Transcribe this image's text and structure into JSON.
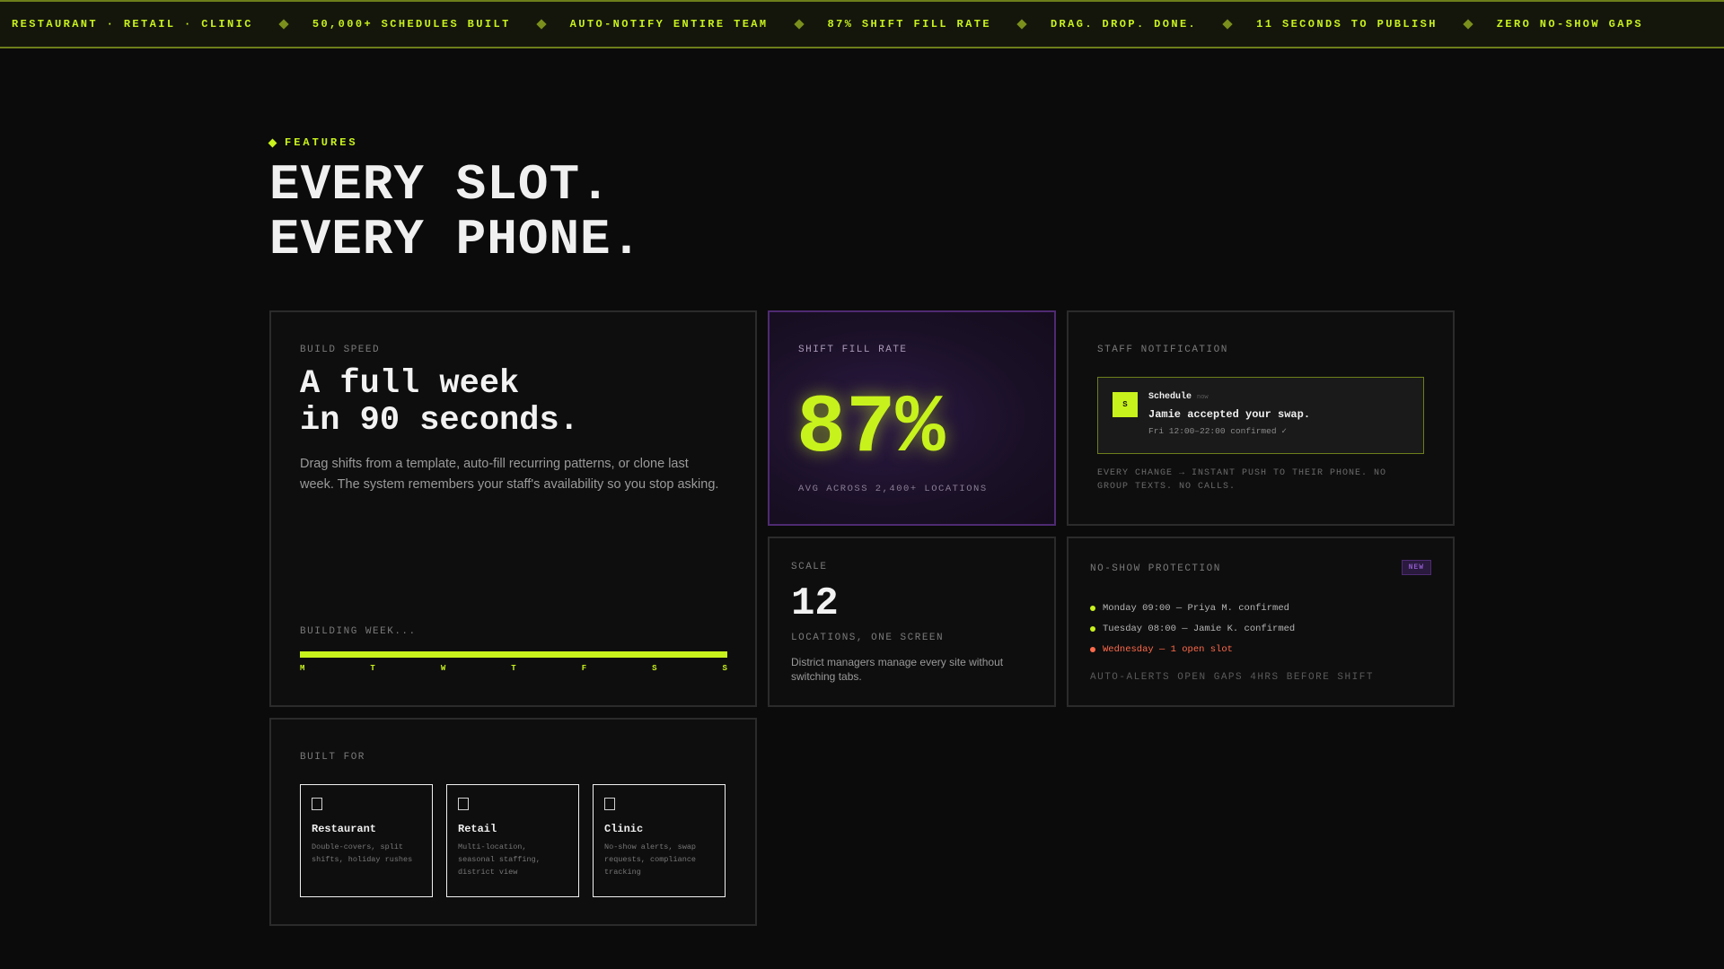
{
  "ticker": [
    "RESTAURANT · RETAIL · CLINIC",
    "50,000+ SCHEDULES BUILT",
    "AUTO-NOTIFY ENTIRE TEAM",
    "87% SHIFT FILL RATE",
    "DRAG. DROP. DONE.",
    "11 SECONDS TO PUBLISH",
    "ZERO NO-SHOW GAPS"
  ],
  "section": {
    "eyebrow": "FEATURES",
    "headline_line1": "EVERY SLOT.",
    "headline_line2": "EVERY PHONE."
  },
  "build": {
    "label": "BUILD SPEED",
    "title_line1": "A full week",
    "title_line2": "in 90 seconds.",
    "description": "Drag shifts from a template, auto-fill recurring patterns, or clone last week. The system remembers your staff's availability so you stop asking.",
    "progress_label": "BUILDING WEEK...",
    "progress": 1.0,
    "days": [
      "M",
      "T",
      "W",
      "T",
      "F",
      "S",
      "S"
    ]
  },
  "fill": {
    "label": "SHIFT FILL RATE",
    "value": "87%",
    "sub": "AVG ACROSS 2,400+ LOCATIONS"
  },
  "notification": {
    "label": "STAFF NOTIFICATION",
    "avatar": "S",
    "app": "Schedule",
    "time": "now",
    "message": "Jamie accepted your swap.",
    "detail": "Fri 12:00–22:00 confirmed ✓",
    "footer": "EVERY CHANGE → INSTANT PUSH TO THEIR PHONE. NO GROUP TEXTS. NO CALLS."
  },
  "scale": {
    "label": "SCALE",
    "value": "12",
    "sub": "LOCATIONS, ONE SCREEN",
    "description": "District managers manage every site without switching tabs."
  },
  "noshow": {
    "label": "NO-SHOW PROTECTION",
    "badge": "NEW",
    "rows": [
      "Monday 09:00 — Priya M. confirmed",
      "Tuesday 08:00 — Jamie K. confirmed",
      "Wednesday — 1 open slot"
    ],
    "footer": "AUTO-ALERTS OPEN GAPS 4HRS BEFORE SHIFT"
  },
  "built_for": {
    "label": "BUILT FOR",
    "tiles": [
      {
        "name": "Restaurant",
        "desc": "Double-covers, split shifts, holiday rushes",
        "icon": "restaurant-icon"
      },
      {
        "name": "Retail",
        "desc": "Multi-location, seasonal staffing, district view",
        "icon": "retail-icon"
      },
      {
        "name": "Clinic",
        "desc": "No-show alerts, swap requests, compliance tracking",
        "icon": "clinic-icon"
      }
    ]
  },
  "colors": {
    "accent": "#c8f21c",
    "purple": "#4e2a72",
    "warning": "#ff6a4a",
    "background": "#0b0b0b"
  }
}
